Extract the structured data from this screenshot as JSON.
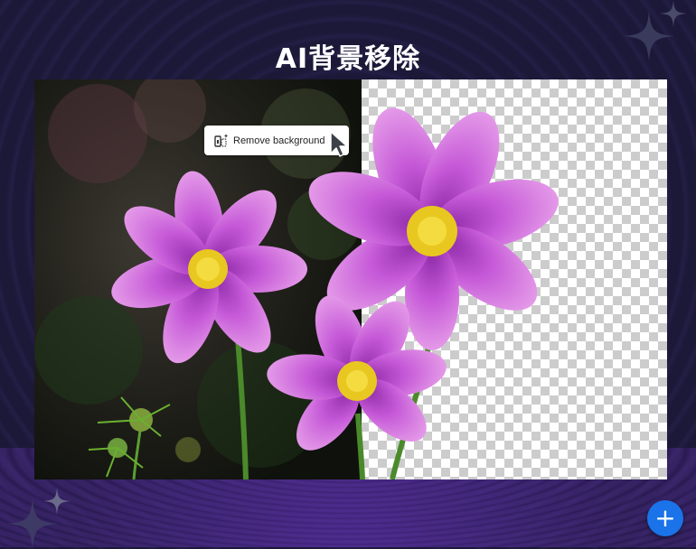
{
  "page": {
    "title": "AI背景移除"
  },
  "demo": {
    "tooltip_label": "Remove background",
    "tooltip_icon": "remove-background-icon",
    "cursor_icon": "arrow-cursor-icon"
  },
  "fab": {
    "label": "+",
    "icon": "plus-icon",
    "color": "#1a73e8"
  },
  "colors": {
    "petal": "#c75ad6",
    "flower_center": "#f0d020",
    "background": "#1b1736"
  }
}
